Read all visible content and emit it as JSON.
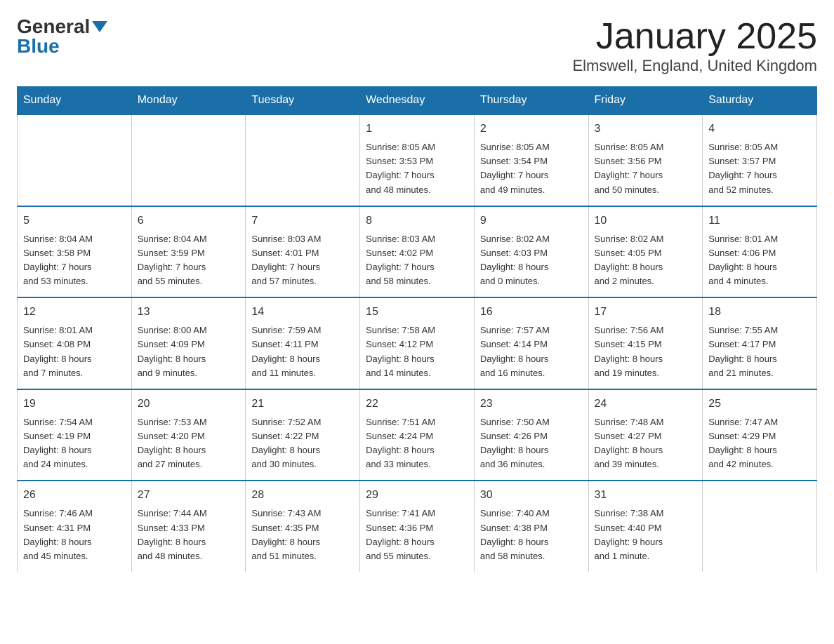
{
  "logo": {
    "general": "General",
    "blue": "Blue",
    "arrow": "▼"
  },
  "title": {
    "month": "January 2025",
    "location": "Elmswell, England, United Kingdom"
  },
  "weekdays": [
    "Sunday",
    "Monday",
    "Tuesday",
    "Wednesday",
    "Thursday",
    "Friday",
    "Saturday"
  ],
  "weeks": [
    [
      {
        "day": "",
        "info": ""
      },
      {
        "day": "",
        "info": ""
      },
      {
        "day": "",
        "info": ""
      },
      {
        "day": "1",
        "info": "Sunrise: 8:05 AM\nSunset: 3:53 PM\nDaylight: 7 hours\nand 48 minutes."
      },
      {
        "day": "2",
        "info": "Sunrise: 8:05 AM\nSunset: 3:54 PM\nDaylight: 7 hours\nand 49 minutes."
      },
      {
        "day": "3",
        "info": "Sunrise: 8:05 AM\nSunset: 3:56 PM\nDaylight: 7 hours\nand 50 minutes."
      },
      {
        "day": "4",
        "info": "Sunrise: 8:05 AM\nSunset: 3:57 PM\nDaylight: 7 hours\nand 52 minutes."
      }
    ],
    [
      {
        "day": "5",
        "info": "Sunrise: 8:04 AM\nSunset: 3:58 PM\nDaylight: 7 hours\nand 53 minutes."
      },
      {
        "day": "6",
        "info": "Sunrise: 8:04 AM\nSunset: 3:59 PM\nDaylight: 7 hours\nand 55 minutes."
      },
      {
        "day": "7",
        "info": "Sunrise: 8:03 AM\nSunset: 4:01 PM\nDaylight: 7 hours\nand 57 minutes."
      },
      {
        "day": "8",
        "info": "Sunrise: 8:03 AM\nSunset: 4:02 PM\nDaylight: 7 hours\nand 58 minutes."
      },
      {
        "day": "9",
        "info": "Sunrise: 8:02 AM\nSunset: 4:03 PM\nDaylight: 8 hours\nand 0 minutes."
      },
      {
        "day": "10",
        "info": "Sunrise: 8:02 AM\nSunset: 4:05 PM\nDaylight: 8 hours\nand 2 minutes."
      },
      {
        "day": "11",
        "info": "Sunrise: 8:01 AM\nSunset: 4:06 PM\nDaylight: 8 hours\nand 4 minutes."
      }
    ],
    [
      {
        "day": "12",
        "info": "Sunrise: 8:01 AM\nSunset: 4:08 PM\nDaylight: 8 hours\nand 7 minutes."
      },
      {
        "day": "13",
        "info": "Sunrise: 8:00 AM\nSunset: 4:09 PM\nDaylight: 8 hours\nand 9 minutes."
      },
      {
        "day": "14",
        "info": "Sunrise: 7:59 AM\nSunset: 4:11 PM\nDaylight: 8 hours\nand 11 minutes."
      },
      {
        "day": "15",
        "info": "Sunrise: 7:58 AM\nSunset: 4:12 PM\nDaylight: 8 hours\nand 14 minutes."
      },
      {
        "day": "16",
        "info": "Sunrise: 7:57 AM\nSunset: 4:14 PM\nDaylight: 8 hours\nand 16 minutes."
      },
      {
        "day": "17",
        "info": "Sunrise: 7:56 AM\nSunset: 4:15 PM\nDaylight: 8 hours\nand 19 minutes."
      },
      {
        "day": "18",
        "info": "Sunrise: 7:55 AM\nSunset: 4:17 PM\nDaylight: 8 hours\nand 21 minutes."
      }
    ],
    [
      {
        "day": "19",
        "info": "Sunrise: 7:54 AM\nSunset: 4:19 PM\nDaylight: 8 hours\nand 24 minutes."
      },
      {
        "day": "20",
        "info": "Sunrise: 7:53 AM\nSunset: 4:20 PM\nDaylight: 8 hours\nand 27 minutes."
      },
      {
        "day": "21",
        "info": "Sunrise: 7:52 AM\nSunset: 4:22 PM\nDaylight: 8 hours\nand 30 minutes."
      },
      {
        "day": "22",
        "info": "Sunrise: 7:51 AM\nSunset: 4:24 PM\nDaylight: 8 hours\nand 33 minutes."
      },
      {
        "day": "23",
        "info": "Sunrise: 7:50 AM\nSunset: 4:26 PM\nDaylight: 8 hours\nand 36 minutes."
      },
      {
        "day": "24",
        "info": "Sunrise: 7:48 AM\nSunset: 4:27 PM\nDaylight: 8 hours\nand 39 minutes."
      },
      {
        "day": "25",
        "info": "Sunrise: 7:47 AM\nSunset: 4:29 PM\nDaylight: 8 hours\nand 42 minutes."
      }
    ],
    [
      {
        "day": "26",
        "info": "Sunrise: 7:46 AM\nSunset: 4:31 PM\nDaylight: 8 hours\nand 45 minutes."
      },
      {
        "day": "27",
        "info": "Sunrise: 7:44 AM\nSunset: 4:33 PM\nDaylight: 8 hours\nand 48 minutes."
      },
      {
        "day": "28",
        "info": "Sunrise: 7:43 AM\nSunset: 4:35 PM\nDaylight: 8 hours\nand 51 minutes."
      },
      {
        "day": "29",
        "info": "Sunrise: 7:41 AM\nSunset: 4:36 PM\nDaylight: 8 hours\nand 55 minutes."
      },
      {
        "day": "30",
        "info": "Sunrise: 7:40 AM\nSunset: 4:38 PM\nDaylight: 8 hours\nand 58 minutes."
      },
      {
        "day": "31",
        "info": "Sunrise: 7:38 AM\nSunset: 4:40 PM\nDaylight: 9 hours\nand 1 minute."
      },
      {
        "day": "",
        "info": ""
      }
    ]
  ]
}
